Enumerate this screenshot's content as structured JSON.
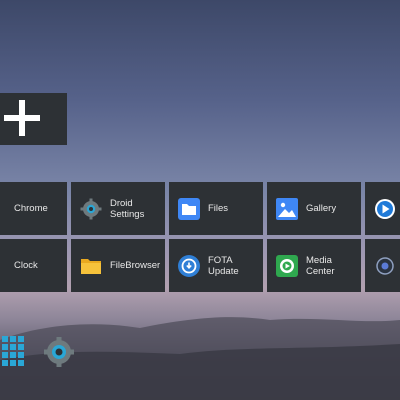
{
  "apps": [
    {
      "label": "Chrome",
      "icon": "chrome-icon"
    },
    {
      "label": "Droid Settings",
      "icon": "droid-settings-icon"
    },
    {
      "label": "Files",
      "icon": "files-icon"
    },
    {
      "label": "Gallery",
      "icon": "gallery-icon"
    },
    {
      "label": "",
      "icon": "media-player-icon"
    },
    {
      "label": "Clock",
      "icon": "clock-icon"
    },
    {
      "label": "FileBrowser",
      "icon": "filebrowser-icon"
    },
    {
      "label": "FOTA Update",
      "icon": "fota-update-icon"
    },
    {
      "label": "Media Center",
      "icon": "media-center-icon"
    },
    {
      "label": "",
      "icon": "media-icon"
    }
  ],
  "add_tile": {
    "icon": "plus-icon"
  },
  "dock": {
    "apps_icon": "apps-grid-icon",
    "settings_icon": "settings-icon"
  },
  "colors": {
    "tile": "#2d3135",
    "accent": "#2aa7d6",
    "text": "#e8e8e8"
  }
}
